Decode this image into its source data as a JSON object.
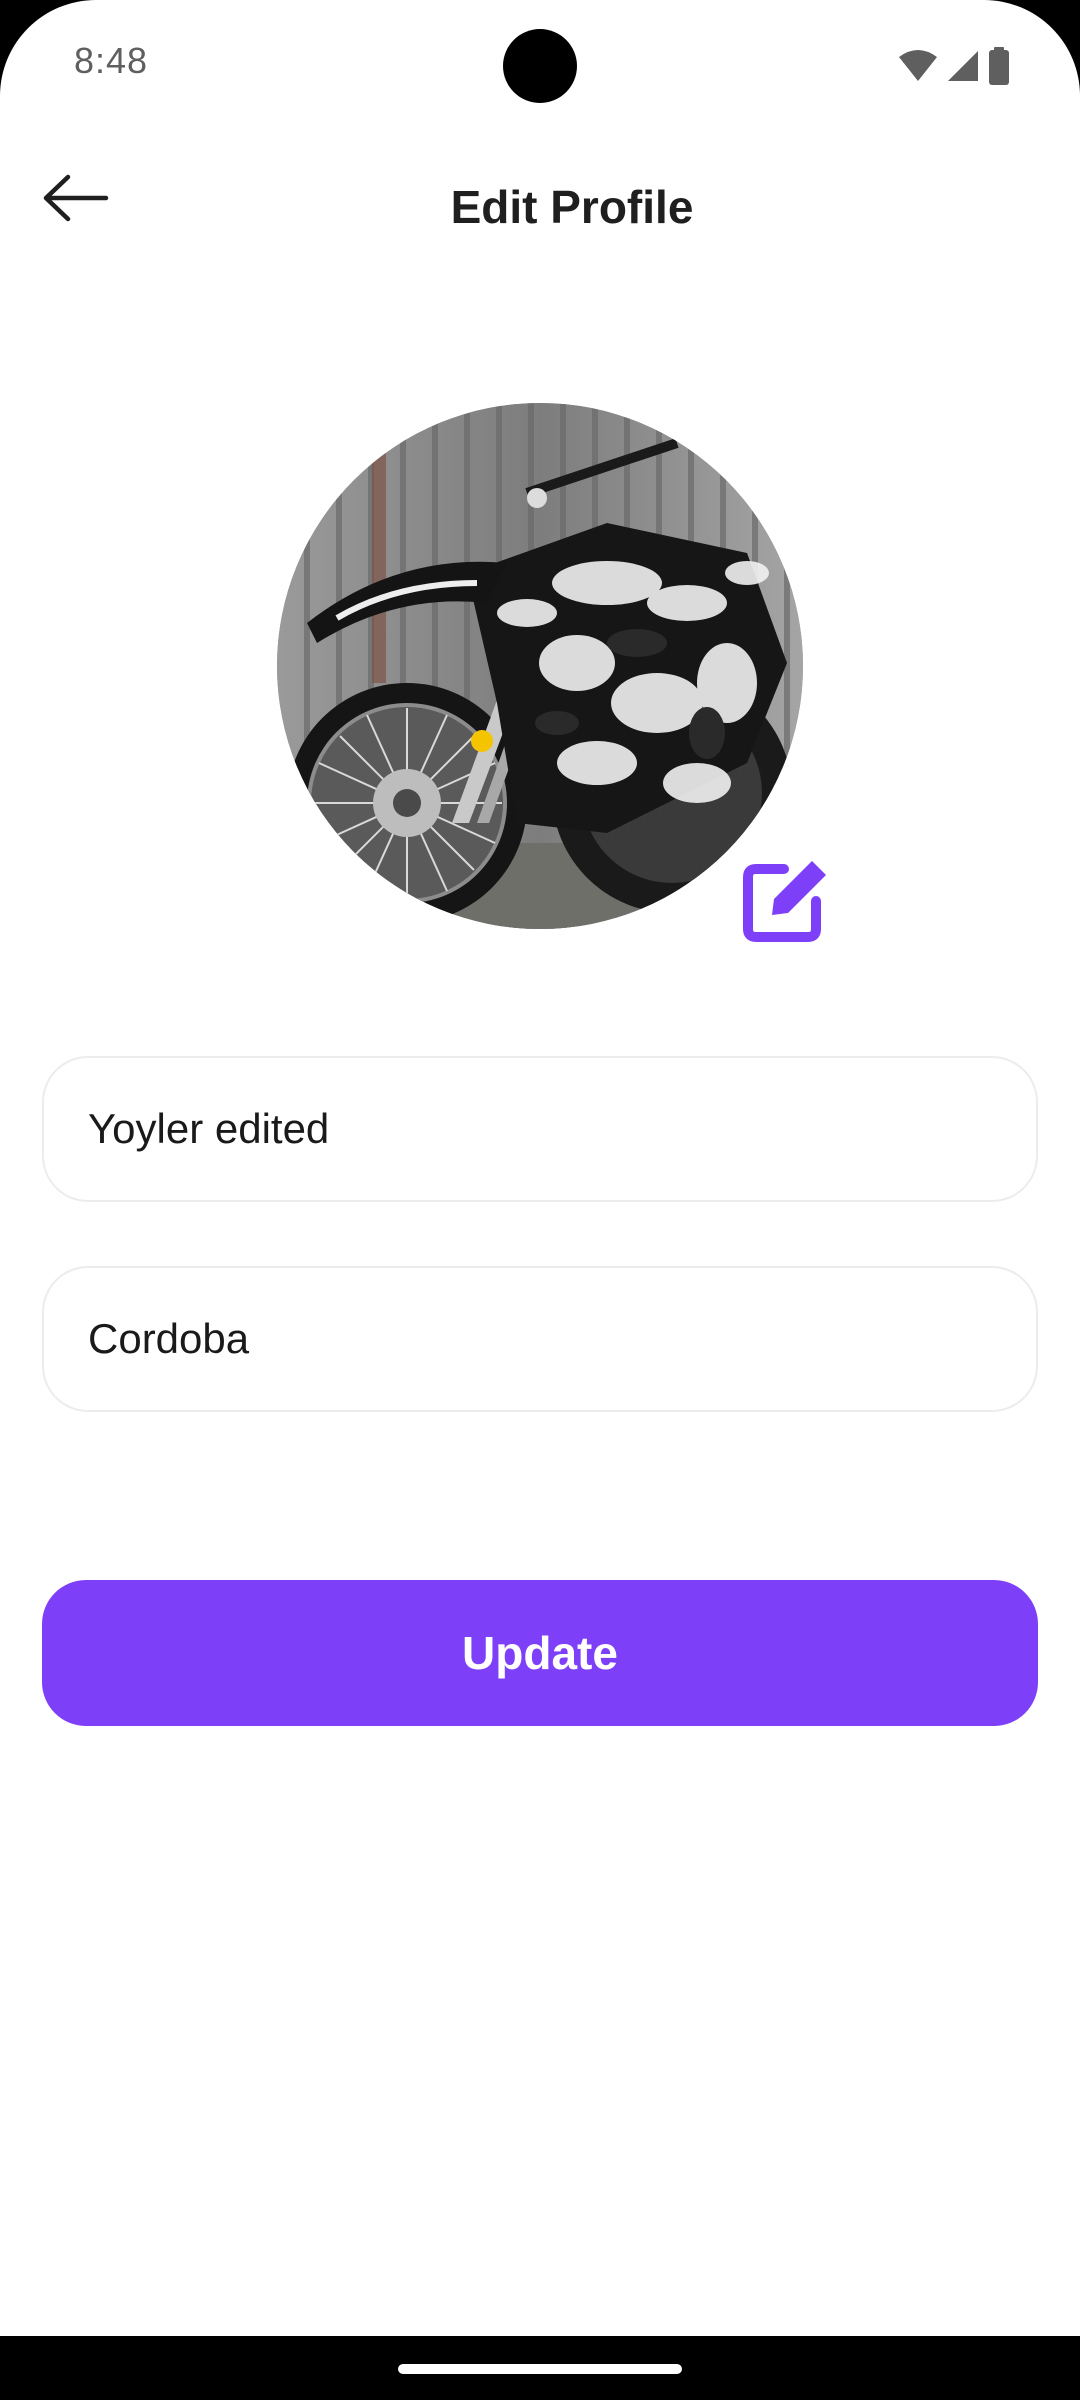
{
  "status_bar": {
    "time": "8:48",
    "icons": [
      "wifi-icon",
      "cellular-signal-icon",
      "battery-icon"
    ]
  },
  "app_bar": {
    "back_icon": "arrow-left-icon",
    "title": "Edit Profile"
  },
  "profile": {
    "avatar": "motorcycle-photo",
    "edit_icon": "edit-square-icon"
  },
  "form": {
    "name_value": "Yoyler edited",
    "city_value": "Cordoba"
  },
  "actions": {
    "update_label": "Update"
  },
  "colors": {
    "accent": "#7e3ff9",
    "title_text": "#1f1f1f",
    "field_border": "#ececef",
    "background": "#ffffff"
  }
}
